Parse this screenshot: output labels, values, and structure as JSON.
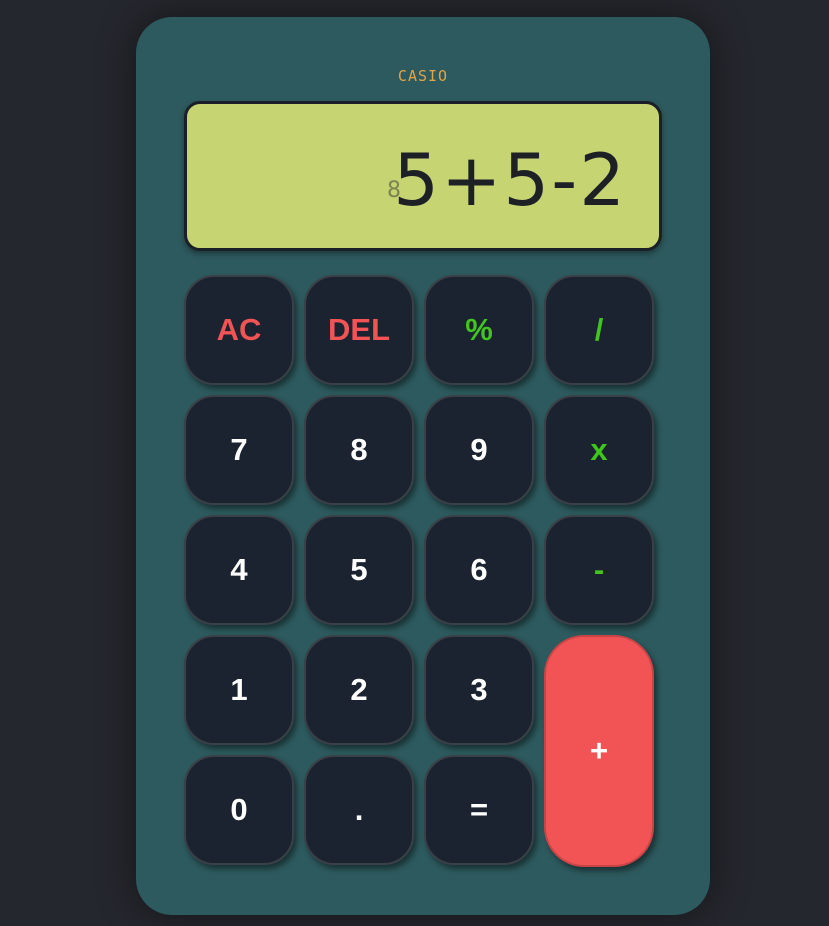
{
  "calculator": {
    "brand": "CASIO",
    "display": {
      "previous": "8",
      "expression": "5+5-2"
    },
    "keys": {
      "ac": "AC",
      "del": "DEL",
      "percent": "%",
      "divide": "/",
      "seven": "7",
      "eight": "8",
      "nine": "9",
      "multiply": "x",
      "four": "4",
      "five": "5",
      "six": "6",
      "minus": "-",
      "one": "1",
      "two": "2",
      "three": "3",
      "plus": "+",
      "zero": "0",
      "decimal": ".",
      "equals": "="
    }
  },
  "colors": {
    "background": "#25272e",
    "body": "#2d5a5e",
    "display": "#c6d472",
    "key": "#1b2230",
    "accent_red": "#f25355",
    "accent_green": "#41c51f",
    "brand": "#e0a44a"
  }
}
